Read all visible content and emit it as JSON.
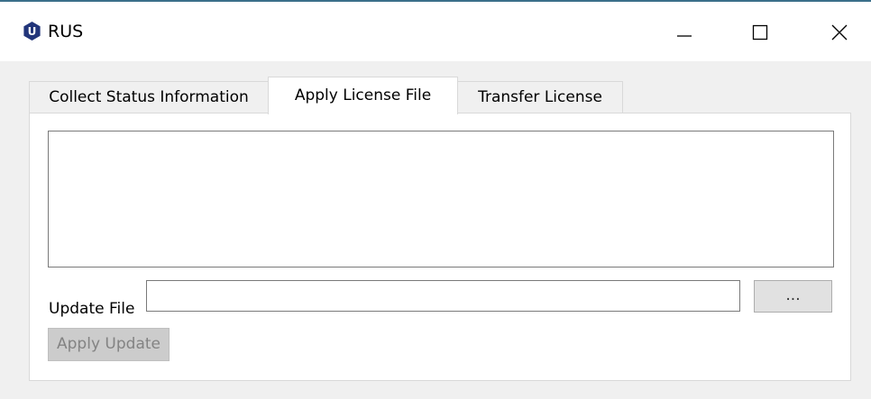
{
  "window": {
    "title": "RUS",
    "icon_name": "app-logo-icon",
    "icon_letter": "U",
    "icon_color": "#22357a",
    "controls": {
      "minimize": "minimize-icon",
      "maximize": "maximize-icon",
      "close": "close-icon"
    }
  },
  "tabs": [
    {
      "label": "Collect Status Information",
      "active": false
    },
    {
      "label": "Apply License File",
      "active": true
    },
    {
      "label": "Transfer License",
      "active": false
    }
  ],
  "apply_tab": {
    "log_text": "",
    "update_file_label": "Update File",
    "update_file_value": "",
    "browse_label": "...",
    "apply_button_label": "Apply Update",
    "apply_button_enabled": false
  }
}
